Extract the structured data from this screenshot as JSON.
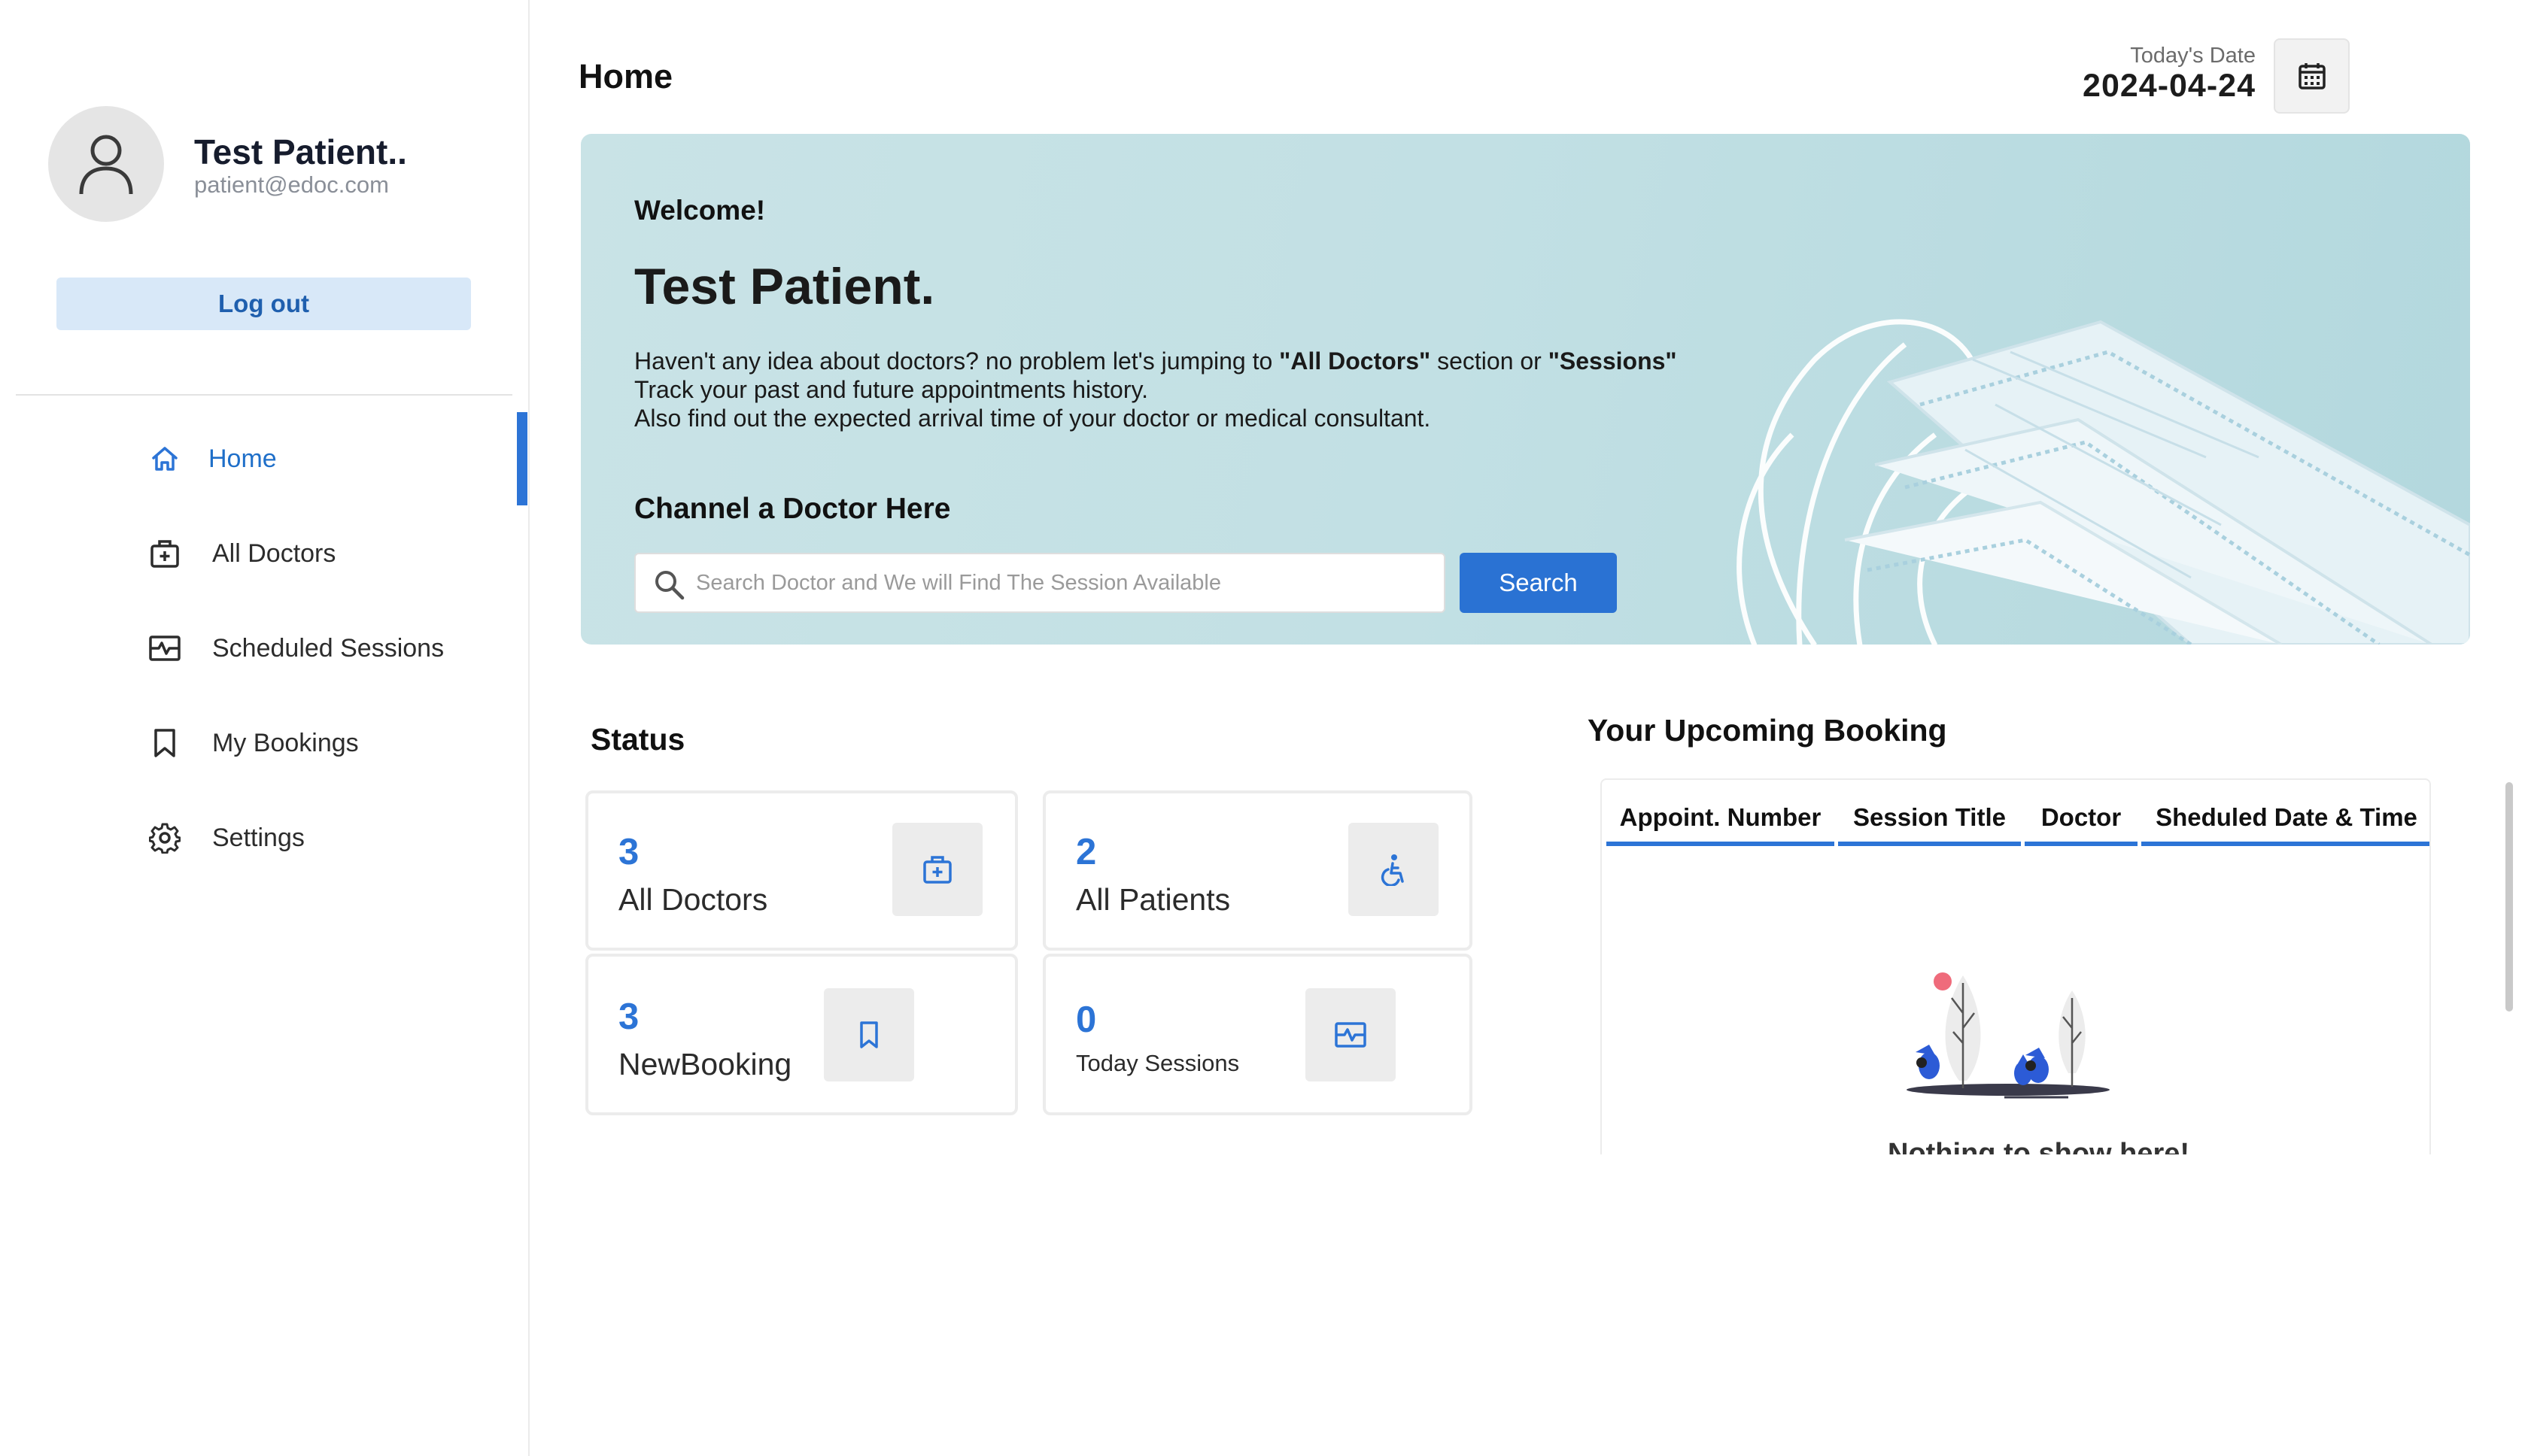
{
  "profile": {
    "name": "Test Patient..",
    "email": "patient@edoc.com",
    "logout_label": "Log out"
  },
  "nav": {
    "items": [
      {
        "label": "Home",
        "icon": "home-icon",
        "active": true
      },
      {
        "label": "All Doctors",
        "icon": "doctor-bag-icon",
        "active": false
      },
      {
        "label": "Scheduled Sessions",
        "icon": "session-icon",
        "active": false
      },
      {
        "label": "My Bookings",
        "icon": "bookmark-icon",
        "active": false
      },
      {
        "label": "Settings",
        "icon": "gear-icon",
        "active": false
      }
    ]
  },
  "header": {
    "title": "Home",
    "date_caption": "Today's Date",
    "date_value": "2024-04-24",
    "calendar_icon": "calendar-icon"
  },
  "hero": {
    "welcome": "Welcome!",
    "name": "Test Patient.",
    "line1_a": "Haven't any idea about doctors? no problem let's jumping to ",
    "line1_b": "\"All Doctors\"",
    "line1_c": " section or ",
    "line1_d": "\"Sessions\"",
    "line2": "Track your past and future appointments history.",
    "line3": "Also find out the expected arrival time of your doctor or medical consultant.",
    "channel_title": "Channel a Doctor Here",
    "search_placeholder": "Search Doctor and We will Find The Session Available",
    "search_button": "Search"
  },
  "status": {
    "title": "Status",
    "cards": [
      {
        "value": "3",
        "label": "All Doctors",
        "icon": "doctor-bag-icon"
      },
      {
        "value": "2",
        "label": "All Patients",
        "icon": "wheelchair-icon"
      },
      {
        "value": "3",
        "label": "NewBooking",
        "icon": "bookmark-icon"
      },
      {
        "value": "0",
        "label": "Today Sessions",
        "icon": "session-icon"
      }
    ]
  },
  "upcoming": {
    "title": "Your Upcoming Booking",
    "columns": [
      "Appoint. Number",
      "Session Title",
      "Doctor",
      "Sheduled Date & Time"
    ],
    "empty_text": "Nothing to show here!"
  },
  "colors": {
    "accent": "#2c74d6",
    "logout_bg": "#d8e8f8",
    "hero_bg": "#c4e1e5",
    "card_icon_bg": "#ececec"
  }
}
